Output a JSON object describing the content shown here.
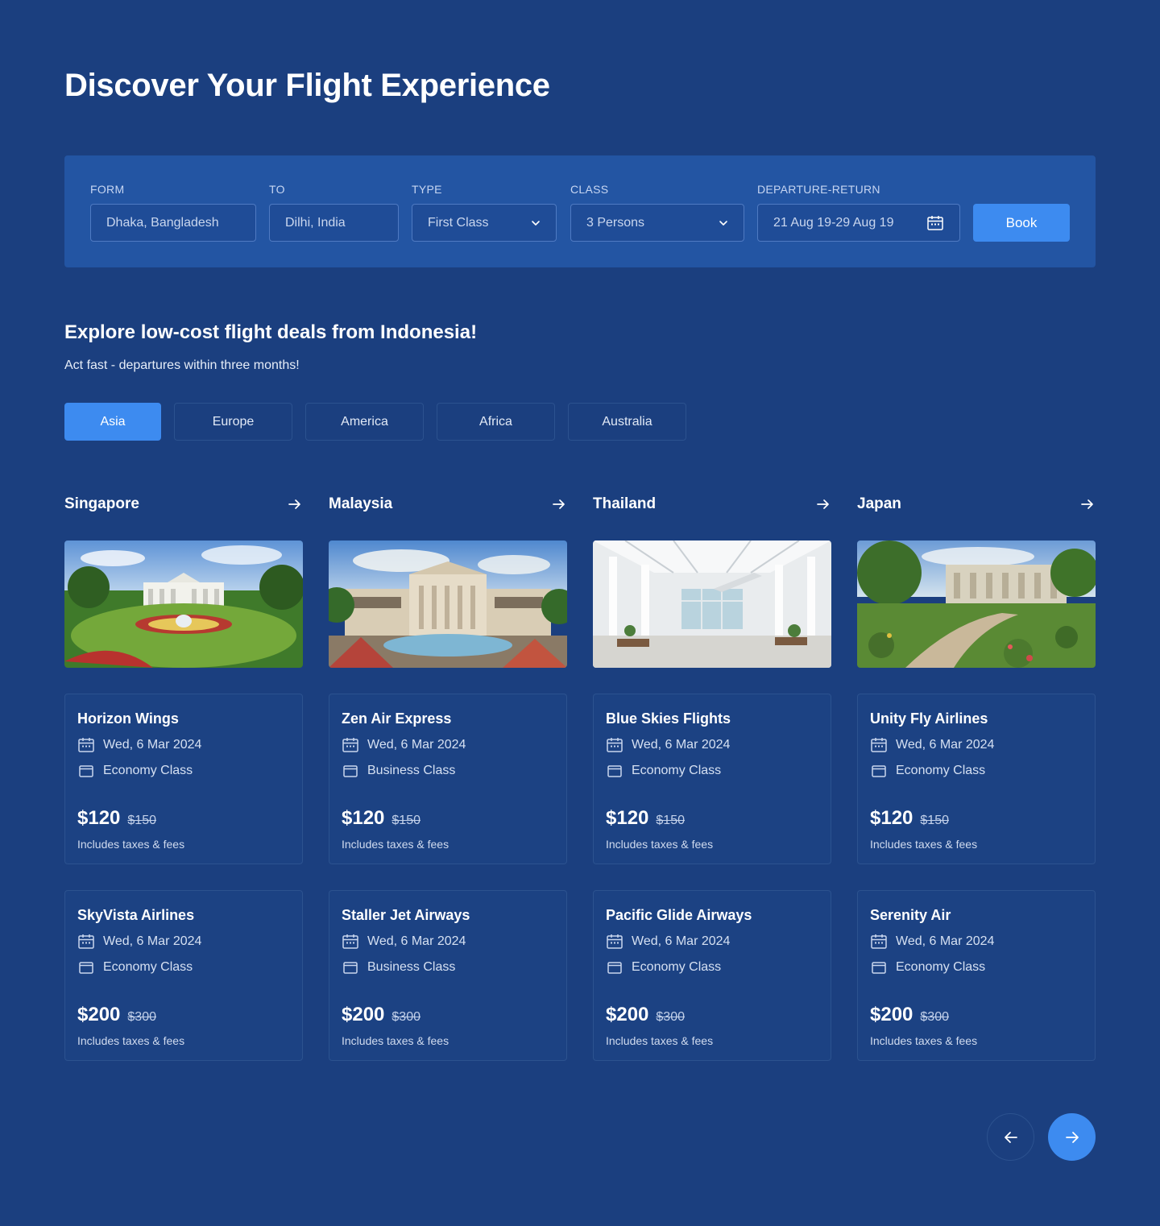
{
  "title": "Discover Your Flight Experience",
  "search": {
    "from_label": "FORM",
    "from_value": "Dhaka, Bangladesh",
    "to_label": "TO",
    "to_value": "Dilhi, India",
    "type_label": "TYPE",
    "type_value": "First Class",
    "class_label": "CLASS",
    "class_value": "3 Persons",
    "dates_label": "DEPARTURE-RETURN",
    "dates_value": "21 Aug 19-29 Aug 19",
    "book_label": "Book"
  },
  "deals": {
    "title": "Explore low-cost flight deals from Indonesia!",
    "subtitle": "Act fast - departures within three months!",
    "tabs": [
      "Asia",
      "Europe",
      "America",
      "Africa",
      "Australia"
    ],
    "active_tab": "Asia"
  },
  "columns": [
    {
      "country": "Singapore",
      "cards": [
        {
          "airline": "Horizon Wings",
          "date": "Wed, 6 Mar 2024",
          "class": "Economy Class",
          "price": "$120",
          "old_price": "$150",
          "note": "Includes taxes & fees"
        },
        {
          "airline": "SkyVista Airlines",
          "date": "Wed, 6 Mar 2024",
          "class": "Economy Class",
          "price": "$200",
          "old_price": "$300",
          "note": "Includes taxes & fees"
        }
      ]
    },
    {
      "country": "Malaysia",
      "cards": [
        {
          "airline": "Zen Air Express",
          "date": "Wed, 6 Mar 2024",
          "class": "Business Class",
          "price": "$120",
          "old_price": "$150",
          "note": "Includes taxes & fees"
        },
        {
          "airline": "Staller Jet Airways",
          "date": "Wed, 6 Mar 2024",
          "class": "Business Class",
          "price": "$200",
          "old_price": "$300",
          "note": "Includes taxes & fees"
        }
      ]
    },
    {
      "country": "Thailand",
      "cards": [
        {
          "airline": "Blue Skies Flights",
          "date": "Wed, 6 Mar 2024",
          "class": "Economy Class",
          "price": "$120",
          "old_price": "$150",
          "note": "Includes taxes & fees"
        },
        {
          "airline": "Pacific Glide Airways",
          "date": "Wed, 6 Mar 2024",
          "class": "Economy Class",
          "price": "$200",
          "old_price": "$300",
          "note": "Includes taxes & fees"
        }
      ]
    },
    {
      "country": "Japan",
      "cards": [
        {
          "airline": "Unity Fly Airlines",
          "date": "Wed, 6 Mar 2024",
          "class": "Economy Class",
          "price": "$120",
          "old_price": "$150",
          "note": "Includes taxes & fees"
        },
        {
          "airline": "Serenity Air",
          "date": "Wed, 6 Mar 2024",
          "class": "Economy Class",
          "price": "$200",
          "old_price": "$300",
          "note": "Includes taxes & fees"
        }
      ]
    }
  ],
  "colors": {
    "background": "#1b3f7f",
    "panel": "#2355a3",
    "accent": "#3d8bf0"
  },
  "icons": [
    "chevron-down-icon",
    "calendar-icon",
    "arrow-right-icon",
    "seat-class-icon",
    "arrow-left-icon"
  ]
}
